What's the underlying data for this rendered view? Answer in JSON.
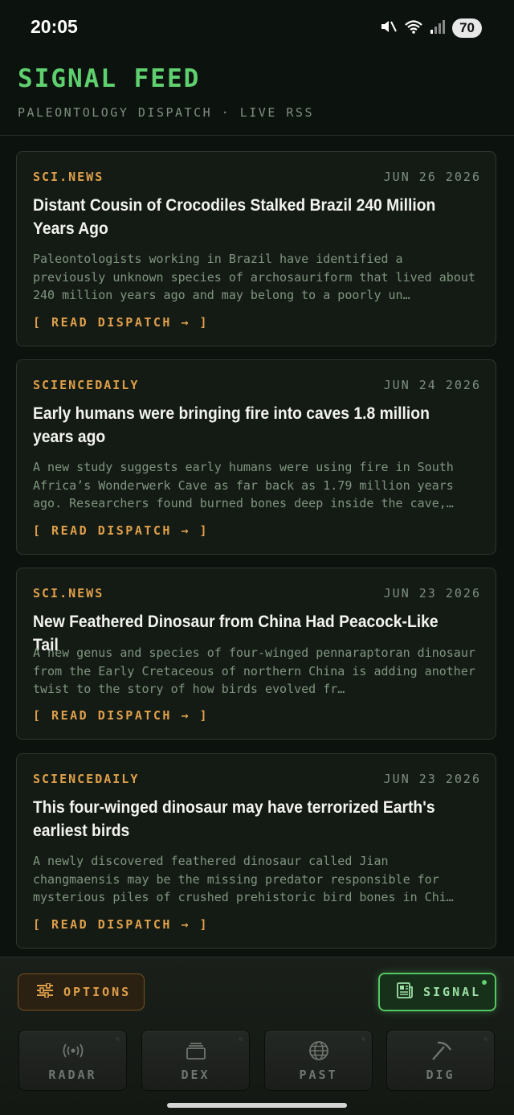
{
  "status_bar": {
    "time": "20:05",
    "battery": "70"
  },
  "header": {
    "title": "SIGNAL FEED",
    "subtitle": "PALEONTOLOGY DISPATCH · LIVE RSS"
  },
  "cards": [
    {
      "source": "SCI.NEWS",
      "date": "JUN 26 2026",
      "title": "Distant Cousin of Crocodiles Stalked Brazil 240 Million Years Ago",
      "summary": "Paleontologists working in Brazil have identified a previously unknown species of archosauriform that lived about 240 million years ago and may belong to a poorly un…",
      "link": "[ READ DISPATCH → ]"
    },
    {
      "source": "SCIENCEDAILY",
      "date": "JUN 24 2026",
      "title": "Early humans were bringing fire into caves 1.8 million years ago",
      "summary": "A new study suggests early humans were using fire in South Africa’s Wonderwerk Cave as far back as 1.79 million years ago. Researchers found burned bones deep inside the cave,…",
      "link": "[ READ DISPATCH → ]"
    },
    {
      "source": "SCI.NEWS",
      "date": "JUN 23 2026",
      "title": "New Feathered Dinosaur from China Had Peacock-Like Tail",
      "summary": "A new genus and species of four-winged pennaraptoran dinosaur from the Early Cretaceous of northern China is adding another twist to the story of how birds evolved fr…",
      "link": "[ READ DISPATCH → ]"
    },
    {
      "source": "SCIENCEDAILY",
      "date": "JUN 23 2026",
      "title": "This four-winged dinosaur may have terrorized Earth's earliest birds",
      "summary": "A newly discovered feathered dinosaur called Jian changmaensis may be the missing predator responsible for mysterious piles of crushed prehistoric bird bones in Chi…",
      "link": "[ READ DISPATCH → ]"
    }
  ],
  "toolbar": {
    "options_label": "OPTIONS",
    "signal_label": "SIGNAL"
  },
  "nav": [
    {
      "label": "RADAR",
      "icon": "radar-icon"
    },
    {
      "label": "DEX",
      "icon": "dex-icon"
    },
    {
      "label": "PAST",
      "icon": "globe-icon"
    },
    {
      "label": "DIG",
      "icon": "pickaxe-icon"
    }
  ],
  "colors": {
    "accent_green": "#5fd06f",
    "accent_amber": "#e0a04a",
    "background": "#0c120d",
    "card_background": "#141b15"
  }
}
